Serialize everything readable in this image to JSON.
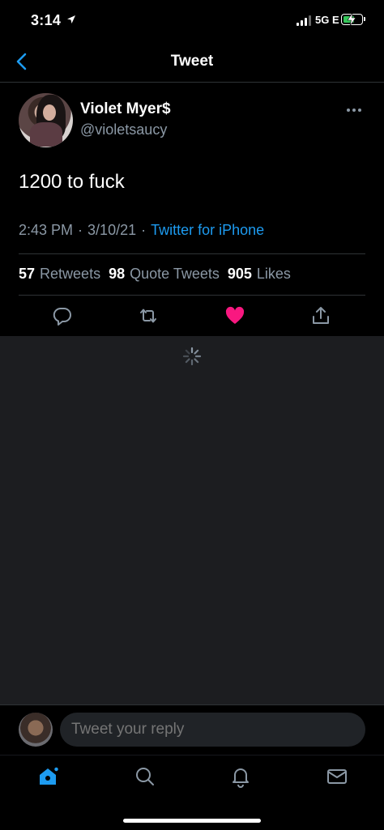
{
  "status_bar": {
    "time": "3:14",
    "network": "5G E",
    "battery_level": 0.6,
    "colors": {
      "battery": "#34c759"
    }
  },
  "nav": {
    "title": "Tweet",
    "back_icon": "chevron-left-icon"
  },
  "tweet": {
    "author": {
      "display_name": "Violet Myer$",
      "handle": "@violetsaucy"
    },
    "text": "1200 to fuck",
    "time": "2:43 PM",
    "date": "3/10/21",
    "separator": "·",
    "source": "Twitter for iPhone",
    "stats": {
      "retweets_count": "57",
      "retweets_label": "Retweets",
      "quotes_count": "98",
      "quotes_label": "Quote Tweets",
      "likes_count": "905",
      "likes_label": "Likes"
    },
    "actions": [
      "reply-icon",
      "retweet-icon",
      "like-icon",
      "share-icon"
    ],
    "liked": true
  },
  "reply": {
    "placeholder": "Tweet your reply"
  },
  "tab_bar": {
    "tabs": [
      "home-icon",
      "search-icon",
      "notifications-icon",
      "messages-icon"
    ],
    "active": "home-icon"
  },
  "colors": {
    "accent": "#1d9bf0",
    "like": "#f91880",
    "secondary_text": "#8b98a5",
    "background": "#000000",
    "loading_background": "#1c1d20"
  }
}
